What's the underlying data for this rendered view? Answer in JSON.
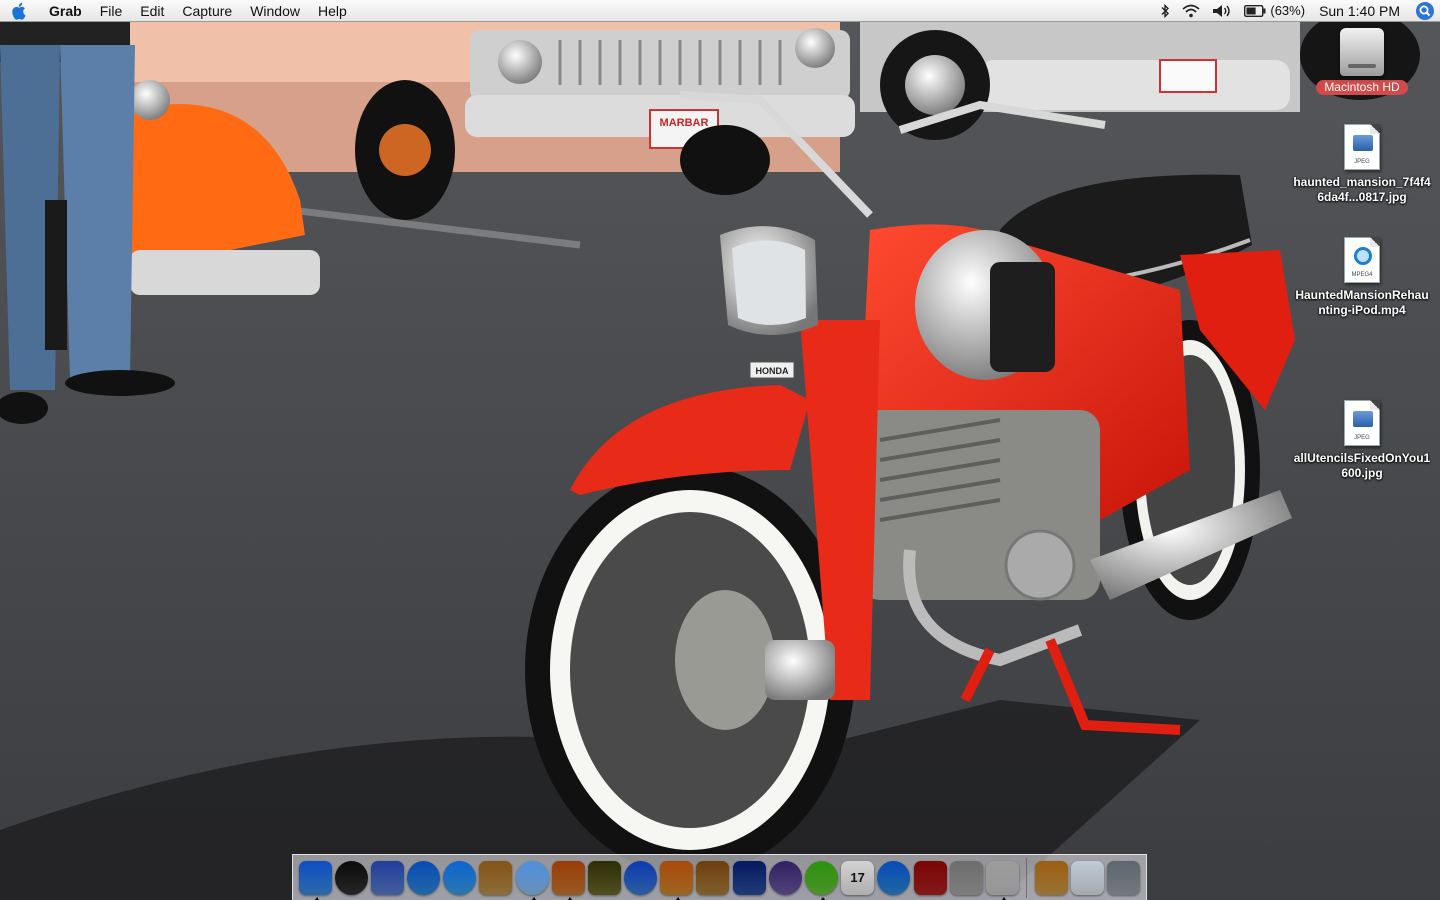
{
  "menubar": {
    "apple_icon": "apple-icon",
    "app_name": "Grab",
    "menus": [
      "File",
      "Edit",
      "Capture",
      "Window",
      "Help"
    ],
    "status": {
      "bluetooth_icon": "bluetooth-icon",
      "wifi_icon": "wifi-icon",
      "volume_icon": "volume-icon",
      "battery_icon": "battery-icon",
      "battery_percent": "(63%)",
      "battery_level": 0.63
    },
    "clock": "Sun 1:40 PM",
    "spotlight_icon": "spotlight-icon"
  },
  "desktop": {
    "icons": [
      {
        "label": "Macintosh HD",
        "kind": "hard-drive-icon"
      },
      {
        "label": "haunted_mansion_7f4f46da4f...0817.jpg",
        "kind": "jpeg-file-icon",
        "tag": "JPEG"
      },
      {
        "label": "HauntedMansionRehaunting-iPod.mp4",
        "kind": "mpeg4-file-icon",
        "tag": "MPEG4"
      },
      {
        "label": "allUtencilsFixedOnYou1600.jpg",
        "kind": "jpeg-file-icon",
        "tag": "JPEG"
      }
    ]
  },
  "wallpaper": {
    "license_plate_text": "MARBAR",
    "badge_text": "HONDA"
  },
  "dock": {
    "apps": [
      {
        "name": "finder",
        "icon": "finder-icon",
        "running": true,
        "color": "#3d8de0"
      },
      {
        "name": "dashboard",
        "icon": "dashboard-icon",
        "running": false,
        "color": "#333"
      },
      {
        "name": "mail",
        "icon": "mail-icon",
        "running": false,
        "color": "#5b7ec9"
      },
      {
        "name": "safari",
        "icon": "safari-icon",
        "running": false,
        "color": "#2f8ad9"
      },
      {
        "name": "ichat",
        "icon": "ichat-icon",
        "running": false,
        "color": "#3aa0e8"
      },
      {
        "name": "address-book",
        "icon": "address-book-icon",
        "running": false,
        "color": "#b8924d"
      },
      {
        "name": "itunes",
        "icon": "itunes-icon",
        "running": true,
        "color": "#8dc0f0"
      },
      {
        "name": "iphoto",
        "icon": "iphoto-icon",
        "running": true,
        "color": "#c77b2d"
      },
      {
        "name": "imovie",
        "icon": "imovie-icon",
        "running": false,
        "color": "#6b6b2a"
      },
      {
        "name": "idvd",
        "icon": "idvd-icon",
        "running": false,
        "color": "#3a7bd5"
      },
      {
        "name": "garageband",
        "icon": "garageband-icon",
        "running": true,
        "color": "#d0892f"
      },
      {
        "name": "preview",
        "icon": "preview-icon",
        "running": false,
        "color": "#a87e3a"
      },
      {
        "name": "clapboard",
        "icon": "clapboard-icon",
        "running": false,
        "color": "#2b4f9e"
      },
      {
        "name": "dvd-player",
        "icon": "dvd-player-icon",
        "running": false,
        "color": "#6f5aa0"
      },
      {
        "name": "front-row",
        "icon": "front-row-icon",
        "running": true,
        "color": "#67c23a"
      },
      {
        "name": "ical",
        "icon": "ical-icon",
        "running": false,
        "color": "#e8e8e8",
        "text": "17"
      },
      {
        "name": "quicktime",
        "icon": "quicktime-icon",
        "running": false,
        "color": "#2b8ad9"
      },
      {
        "name": "photo-booth",
        "icon": "photo-booth-icon",
        "running": false,
        "color": "#b02222"
      },
      {
        "name": "system-preferences",
        "icon": "system-preferences-icon",
        "running": false,
        "color": "#a7a7a7"
      },
      {
        "name": "grab",
        "icon": "grab-icon",
        "running": true,
        "color": "#c8c8c8"
      }
    ],
    "right_items": [
      {
        "name": "applications-stack",
        "icon": "applications-folder-icon",
        "color": "#c89a46"
      },
      {
        "name": "documents-stack",
        "icon": "documents-stack-icon",
        "color": "#dde3ea"
      },
      {
        "name": "trash",
        "icon": "trash-icon",
        "color": "#9aa2a8"
      }
    ]
  }
}
